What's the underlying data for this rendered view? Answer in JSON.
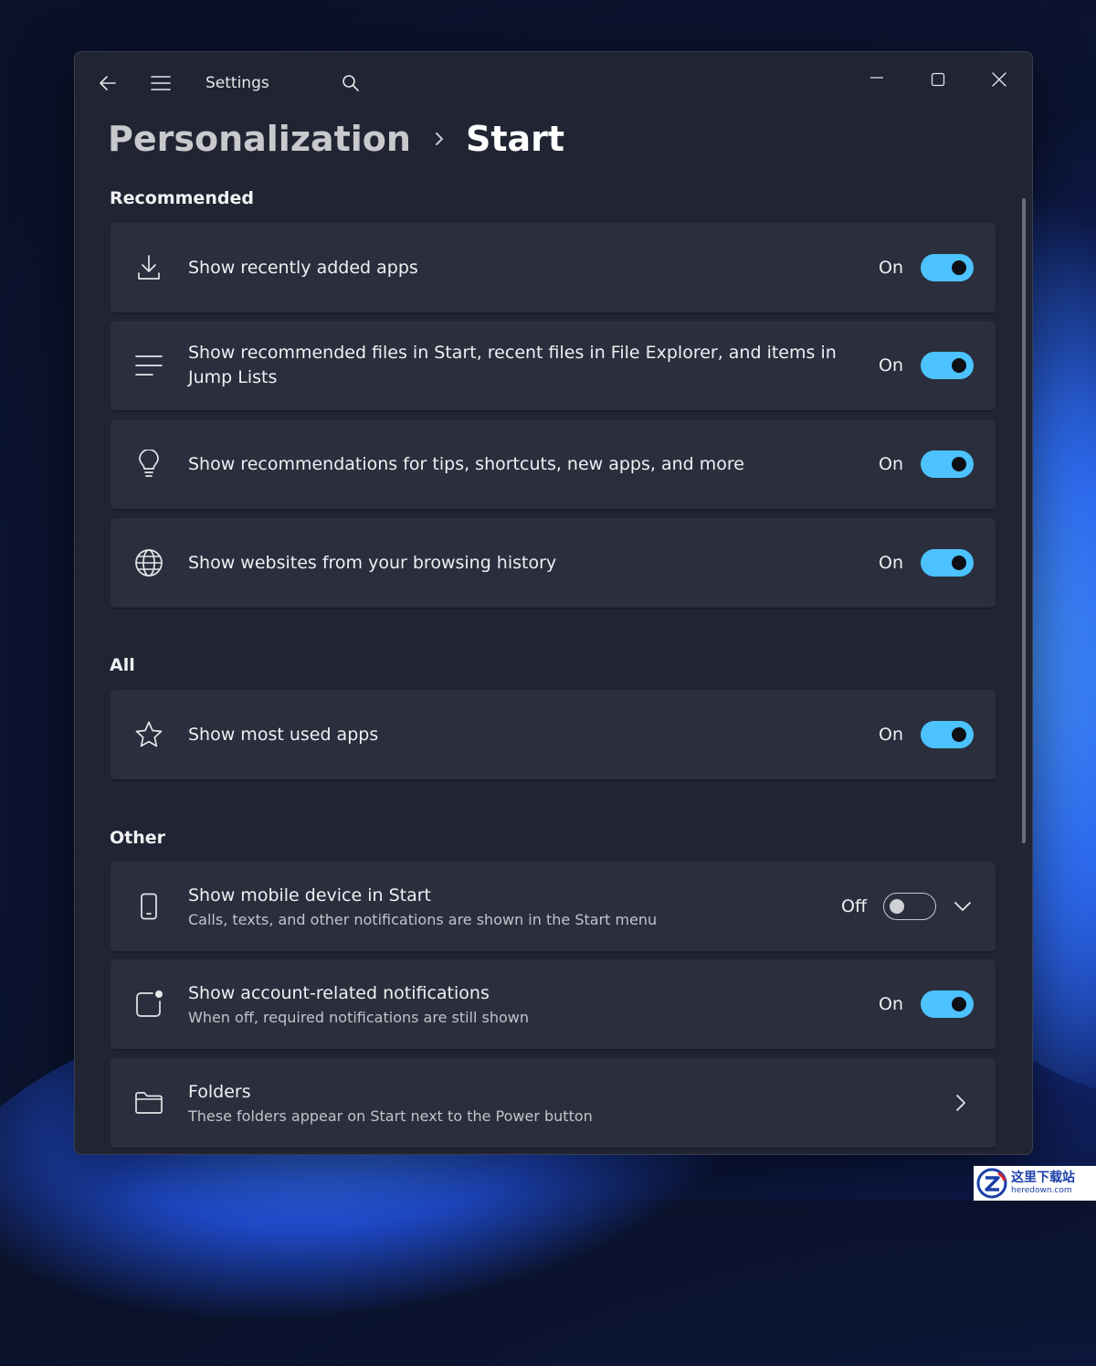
{
  "window": {
    "app_title": "Settings"
  },
  "breadcrumb": {
    "parent": "Personalization",
    "current": "Start"
  },
  "sections": {
    "recommended": "Recommended",
    "all": "All",
    "other": "Other"
  },
  "settings": {
    "recently_added": {
      "label": "Show recently added apps",
      "state": "On",
      "enabled": true,
      "icon": "download-icon"
    },
    "recommended_files": {
      "label": "Show recommended files in Start, recent files in File Explorer, and items in Jump Lists",
      "state": "On",
      "enabled": true,
      "icon": "list-icon"
    },
    "tips": {
      "label": "Show recommendations for tips, shortcuts, new apps, and more",
      "state": "On",
      "enabled": true,
      "icon": "lightbulb-icon"
    },
    "websites": {
      "label": "Show websites from your browsing history",
      "state": "On",
      "enabled": true,
      "icon": "globe-icon"
    },
    "most_used": {
      "label": "Show most used apps",
      "state": "On",
      "enabled": true,
      "icon": "star-icon"
    },
    "mobile": {
      "label": "Show mobile device in Start",
      "sub": "Calls, texts, and other notifications are shown in the Start menu",
      "state": "Off",
      "enabled": false,
      "icon": "phone-icon"
    },
    "account": {
      "label": "Show account-related notifications",
      "sub": "When off, required notifications are still shown",
      "state": "On",
      "enabled": true,
      "icon": "notification-badge-icon"
    },
    "folders": {
      "label": "Folders",
      "sub": "These folders appear on Start next to the Power button",
      "icon": "folder-icon"
    }
  },
  "colors": {
    "accent": "#4cc2ff",
    "window_bg": "#202433",
    "card_bg": "#2a2e3d"
  },
  "watermark": {
    "cn": "这里下载站",
    "en": "heredown.com"
  }
}
